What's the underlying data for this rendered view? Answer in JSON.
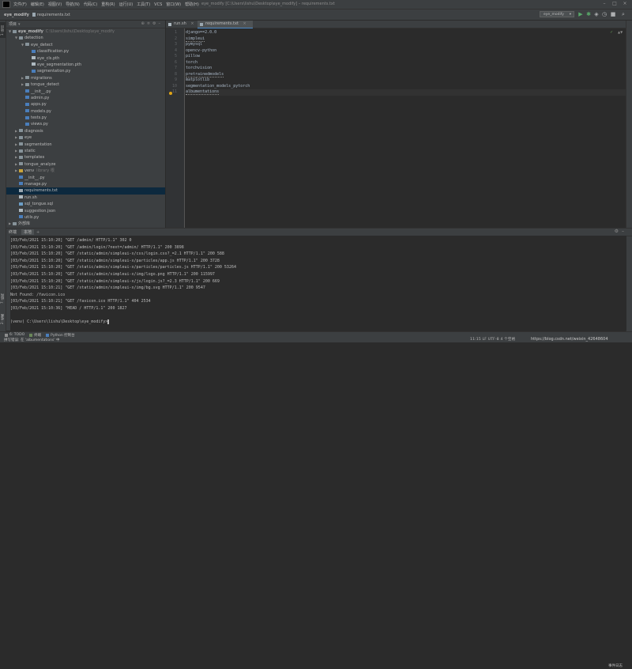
{
  "menubar": {
    "items": [
      "文件(F)",
      "编辑(E)",
      "视图(V)",
      "导航(N)",
      "代码(C)",
      "重构(R)",
      "运行(U)",
      "工具(T)",
      "VCS",
      "窗口(W)",
      "帮助(H)"
    ],
    "window_title": "eye_modify [C:\\Users\\lishu\\Desktop\\eye_modify] – requirements.txt"
  },
  "navbar": {
    "project": "eye_modify",
    "file": "requirements.txt",
    "run_config": "eye_modify"
  },
  "left_strip": {
    "project_label": "1: 项目",
    "structure_label": "7: 结构",
    "favorites_label": "2: 收藏"
  },
  "project_panel": {
    "header": "项目",
    "root": {
      "name": "eye_modify",
      "path": "C:\\Users\\lishu\\Desktop\\eye_modify"
    },
    "tree": [
      {
        "depth": 1,
        "arrow": "open",
        "icon": "folder",
        "name": "detection"
      },
      {
        "depth": 2,
        "arrow": "open",
        "icon": "folder",
        "name": "eye_detect"
      },
      {
        "depth": 3,
        "arrow": "",
        "icon": "py",
        "name": "classification.py"
      },
      {
        "depth": 3,
        "arrow": "",
        "icon": "file",
        "name": "eye_cls.pth"
      },
      {
        "depth": 3,
        "arrow": "",
        "icon": "file",
        "name": "eye_segmentation.pth"
      },
      {
        "depth": 3,
        "arrow": "",
        "icon": "py",
        "name": "segmentation.py"
      },
      {
        "depth": 2,
        "arrow": "closed",
        "icon": "folder",
        "name": "migrations"
      },
      {
        "depth": 2,
        "arrow": "closed",
        "icon": "folder",
        "name": "tongue_detect"
      },
      {
        "depth": 2,
        "arrow": "",
        "icon": "py",
        "name": "__init__.py"
      },
      {
        "depth": 2,
        "arrow": "",
        "icon": "py",
        "name": "admin.py"
      },
      {
        "depth": 2,
        "arrow": "",
        "icon": "py",
        "name": "apps.py"
      },
      {
        "depth": 2,
        "arrow": "",
        "icon": "py",
        "name": "models.py"
      },
      {
        "depth": 2,
        "arrow": "",
        "icon": "py",
        "name": "tests.py"
      },
      {
        "depth": 2,
        "arrow": "",
        "icon": "py",
        "name": "views.py"
      },
      {
        "depth": 1,
        "arrow": "closed",
        "icon": "folder",
        "name": "diagnosis"
      },
      {
        "depth": 1,
        "arrow": "closed",
        "icon": "folder",
        "name": "eye"
      },
      {
        "depth": 1,
        "arrow": "closed",
        "icon": "folder",
        "name": "segmentation"
      },
      {
        "depth": 1,
        "arrow": "closed",
        "icon": "folder",
        "name": "static"
      },
      {
        "depth": 1,
        "arrow": "closed",
        "icon": "folder",
        "name": "templates"
      },
      {
        "depth": 1,
        "arrow": "closed",
        "icon": "folder",
        "name": "tongue_analyze"
      },
      {
        "depth": 1,
        "arrow": "closed",
        "icon": "venv",
        "name": "venv",
        "hint": "library 根"
      },
      {
        "depth": 1,
        "arrow": "",
        "icon": "py",
        "name": "__init__.py"
      },
      {
        "depth": 1,
        "arrow": "",
        "icon": "py",
        "name": "manage.py"
      },
      {
        "depth": 1,
        "arrow": "",
        "icon": "txt",
        "name": "requirements.txt",
        "selected": true
      },
      {
        "depth": 1,
        "arrow": "",
        "icon": "file",
        "name": "run.sh"
      },
      {
        "depth": 1,
        "arrow": "",
        "icon": "sqlite",
        "name": "sql_tongue.sql"
      },
      {
        "depth": 1,
        "arrow": "",
        "icon": "file",
        "name": "suggestion.json"
      },
      {
        "depth": 1,
        "arrow": "",
        "icon": "py",
        "name": "utils.py"
      },
      {
        "depth": 0,
        "arrow": "closed",
        "icon": "folder",
        "name": "外部库"
      }
    ]
  },
  "editor": {
    "tabs": [
      {
        "label": "run.sh",
        "active": false
      },
      {
        "label": "requirements.txt",
        "active": true
      }
    ],
    "lines": [
      "django==2.0.0",
      "simpleui",
      "pymysql",
      "opencv-python",
      "pillow",
      "torch",
      "torchvision",
      "pretrainedmodels",
      "matplotlib",
      "segmentation_models_pytorch",
      "albumentations"
    ],
    "line_numbers": [
      "1",
      "2",
      "3",
      "4",
      "5",
      "6",
      "7",
      "8",
      "9",
      "10",
      "11"
    ]
  },
  "terminal": {
    "label": "终端",
    "tab": "本地",
    "lines": [
      "[03/Feb/2021 15:10:20] \"GET /admin/ HTTP/1.1\" 302 0",
      "[03/Feb/2021 15:10:20] \"GET /admin/login/?next=/admin/ HTTP/1.1\" 200 3898",
      "[03/Feb/2021 15:10:20] \"GET /static/admin/simpleui-x/css/login.css?_=2.1 HTTP/1.1\" 200 588",
      "[03/Feb/2021 15:10:20] \"GET /static/admin/simpleui-x/particles/app.js HTTP/1.1\" 200 3728",
      "[03/Feb/2021 15:10:20] \"GET /static/admin/simpleui-x/particles/particles.js HTTP/1.1\" 200 53264",
      "[03/Feb/2021 15:10:20] \"GET /static/admin/simpleui-x/img/logo.png HTTP/1.1\" 200 115997",
      "[03/Feb/2021 15:10:20] \"GET /static/admin/simpleui-x/js/login.js?_=2.3 HTTP/1.1\" 200 669",
      "[03/Feb/2021 15:10:21] \"GET /static/admin/simpleui-x/img/bg.svg HTTP/1.1\" 200 9547",
      "Not Found: /favicon.ico",
      "[03/Feb/2021 15:10:21] \"GET /favicon.ico HTTP/1.1\" 404 2534",
      "[03/Feb/2021 15:10:36] \"HEAD / HTTP/1.1\" 200 1827",
      "",
      "(venv) C:\\Users\\lishu\\Desktop\\eye_modify>"
    ]
  },
  "bottom_toolbar": {
    "items": [
      "6: TODO",
      "终端",
      "Python 控制台"
    ],
    "event_log": "事件日志"
  },
  "statusbar": {
    "left": "拼写错误: 在 'albumentations' 中",
    "right": "11:15  LF  UTF-8  4 个空格",
    "watermark": "https://blog.csdn.net/weixin_42648604"
  }
}
